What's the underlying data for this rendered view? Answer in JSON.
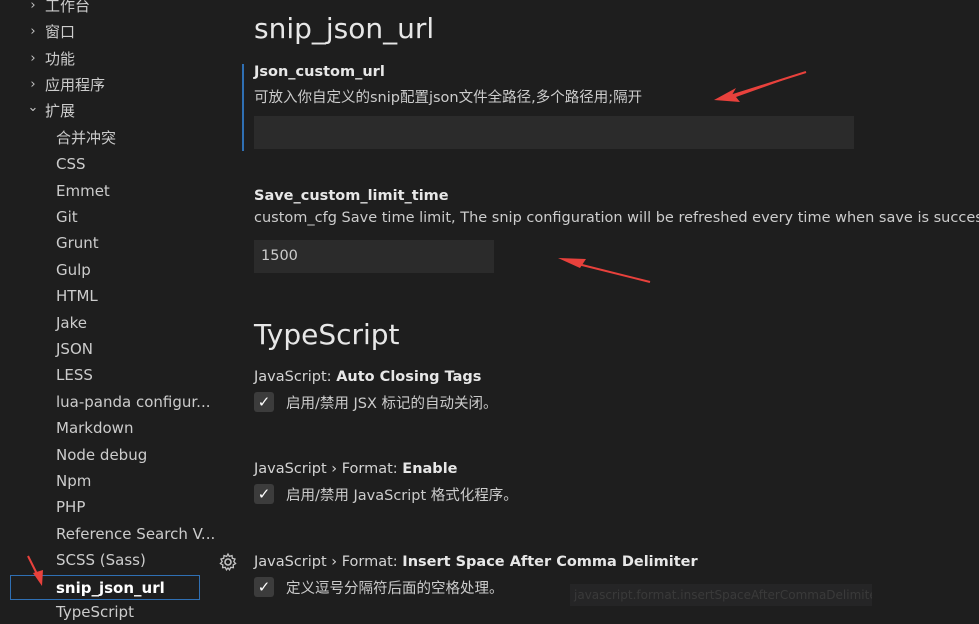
{
  "sidebar": {
    "items": [
      {
        "label": "工作台",
        "expanded": false
      },
      {
        "label": "窗口",
        "expanded": false
      },
      {
        "label": "功能",
        "expanded": false
      },
      {
        "label": "应用程序",
        "expanded": false
      },
      {
        "label": "扩展",
        "expanded": true
      },
      {
        "label": "合并冲突"
      },
      {
        "label": "CSS"
      },
      {
        "label": "Emmet"
      },
      {
        "label": "Git"
      },
      {
        "label": "Grunt"
      },
      {
        "label": "Gulp"
      },
      {
        "label": "HTML"
      },
      {
        "label": "Jake"
      },
      {
        "label": "JSON"
      },
      {
        "label": "LESS"
      },
      {
        "label": "lua-panda configur..."
      },
      {
        "label": "Markdown"
      },
      {
        "label": "Node debug"
      },
      {
        "label": "Npm"
      },
      {
        "label": "PHP"
      },
      {
        "label": "Reference Search V..."
      },
      {
        "label": "SCSS (Sass)"
      },
      {
        "label": "snip_json_url"
      },
      {
        "label": "TypeScript"
      }
    ],
    "selected": "snip_json_url",
    "chevron_right": "›",
    "chevron_down": "⌄"
  },
  "main": {
    "section_title": "snip_json_url",
    "json_custom_url": {
      "title": "Json_custom_url",
      "description": "可放入你自定义的snip配置json文件全路径,多个路径用;隔开",
      "value": ""
    },
    "save_custom_limit_time": {
      "title": "Save_custom_limit_time",
      "description": "custom_cfg Save time limit, The snip configuration will be refreshed every time when save is successful",
      "value": "1500"
    },
    "typescript_title": "TypeScript",
    "auto_closing_tags": {
      "category": "JavaScript: ",
      "title": "Auto Closing Tags",
      "checkbox_label": "启用/禁用 JSX 标记的自动关闭。",
      "checked": true
    },
    "format_enable": {
      "category": "JavaScript › Format: ",
      "title": "Enable",
      "checkbox_label": "启用/禁用 JavaScript 格式化程序。",
      "checked": true
    },
    "insert_space_after_comma": {
      "category": "JavaScript › Format: ",
      "title": "Insert Space After Comma Delimiter",
      "checkbox_label": "定义逗号分隔符后面的空格处理。",
      "checked": true
    },
    "tooltip_text": "javascript.format.insertSpaceAfterCommaDelimiter",
    "check_glyph": "✓"
  },
  "colors": {
    "background": "#1e1e1e",
    "accent": "#2f6fb3",
    "arrow": "#e8413c"
  },
  "icons": [
    "chevron-right-icon",
    "chevron-down-icon",
    "gear-icon",
    "check-icon",
    "red-arrow-annotation"
  ]
}
